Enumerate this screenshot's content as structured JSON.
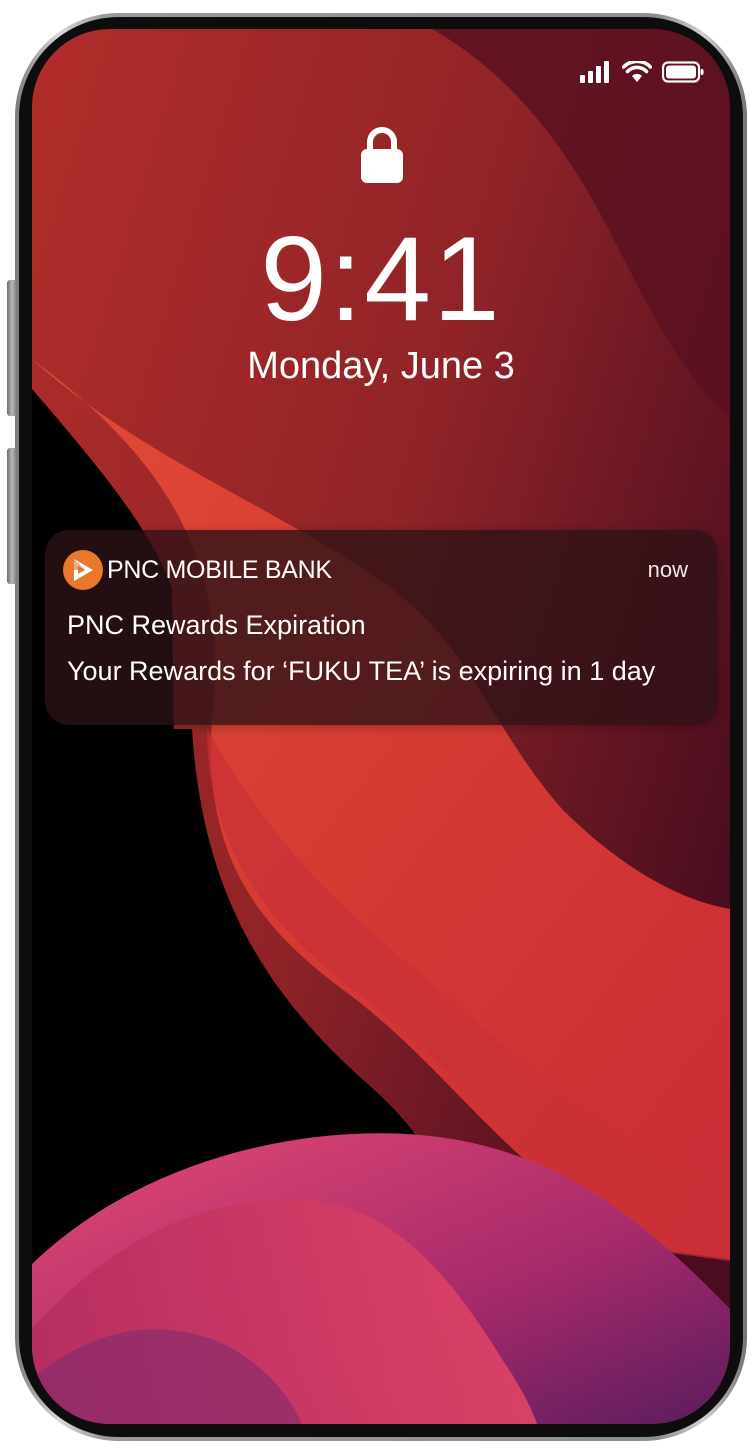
{
  "status_bar": {
    "signal_icon": "cellular-signal-icon",
    "wifi_icon": "wifi-icon",
    "battery_icon": "battery-icon"
  },
  "lock_screen": {
    "lock_icon": "padlock-icon",
    "time": "9:41",
    "date": "Monday, June 3"
  },
  "notification": {
    "app_icon": "pnc-logo-icon",
    "app_name": "PNC MOBILE BANK",
    "time": "now",
    "title": "PNC Rewards Expiration",
    "body": "Your Rewards for ‘FUKU TEA’ is expiring in 1 day"
  },
  "colors": {
    "brand_orange": "#e9782b",
    "wallpaper_red": "#c8352f",
    "wallpaper_magenta": "#d8346c"
  }
}
